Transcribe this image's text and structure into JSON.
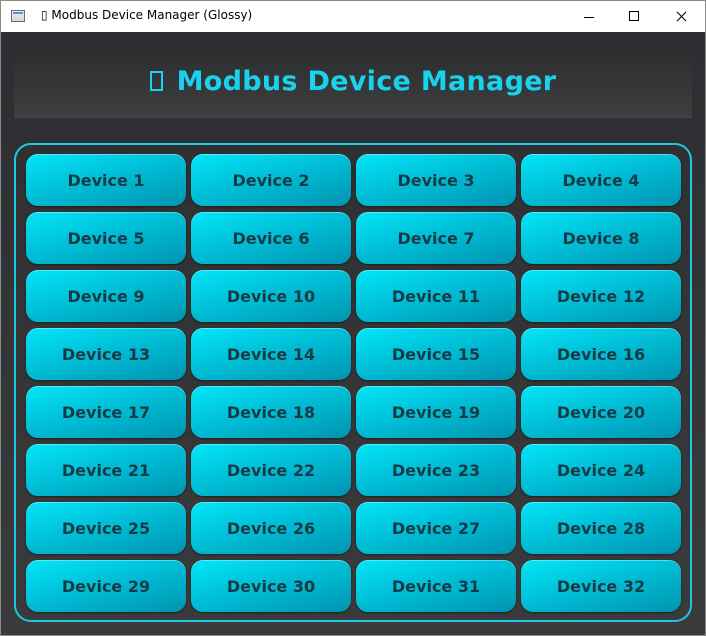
{
  "window": {
    "title": "▯ Modbus Device Manager (Glossy)"
  },
  "header": {
    "title": "Modbus Device Manager",
    "accent_color": "#19d2ee"
  },
  "devices": [
    "Device 1",
    "Device 2",
    "Device 3",
    "Device 4",
    "Device 5",
    "Device 6",
    "Device 7",
    "Device 8",
    "Device 9",
    "Device 10",
    "Device 11",
    "Device 12",
    "Device 13",
    "Device 14",
    "Device 15",
    "Device 16",
    "Device 17",
    "Device 18",
    "Device 19",
    "Device 20",
    "Device 21",
    "Device 22",
    "Device 23",
    "Device 24",
    "Device 25",
    "Device 26",
    "Device 27",
    "Device 28",
    "Device 29",
    "Device 30",
    "Device 31",
    "Device 32"
  ],
  "colors": {
    "background": "#2d2e31",
    "button_gradient_top": "#03e6f8",
    "button_gradient_bottom": "#0094b0",
    "button_text": "#163a45",
    "frame_border": "#1dc8e3"
  }
}
